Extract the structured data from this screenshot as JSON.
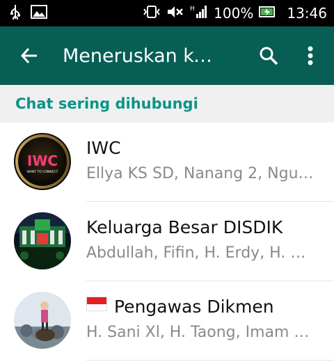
{
  "status_bar": {
    "battery_percent": "100%",
    "time": "13:46"
  },
  "app_bar": {
    "title": "Meneruskan ke…"
  },
  "section": {
    "frequent_label": "Chat sering dihubungi"
  },
  "chats": [
    {
      "name": "IWC",
      "members": "Ellya KS SD, Nanang 2, Ngu…",
      "avatar_text": "IWC",
      "avatar_subtext": "WANT TO CONNECT"
    },
    {
      "name": "Keluarga Besar DISDIK",
      "members": "Abdullah, Fifin, H. Erdy, H. …"
    },
    {
      "name": "Pengawas Dikmen",
      "members": "H. Sani Xl, H. Taong, Imam …",
      "flag": "indonesia-flag"
    }
  ],
  "colors": {
    "app_bar": "#075e54",
    "section_text": "#0a9488",
    "section_bg": "#f0f0f0"
  }
}
